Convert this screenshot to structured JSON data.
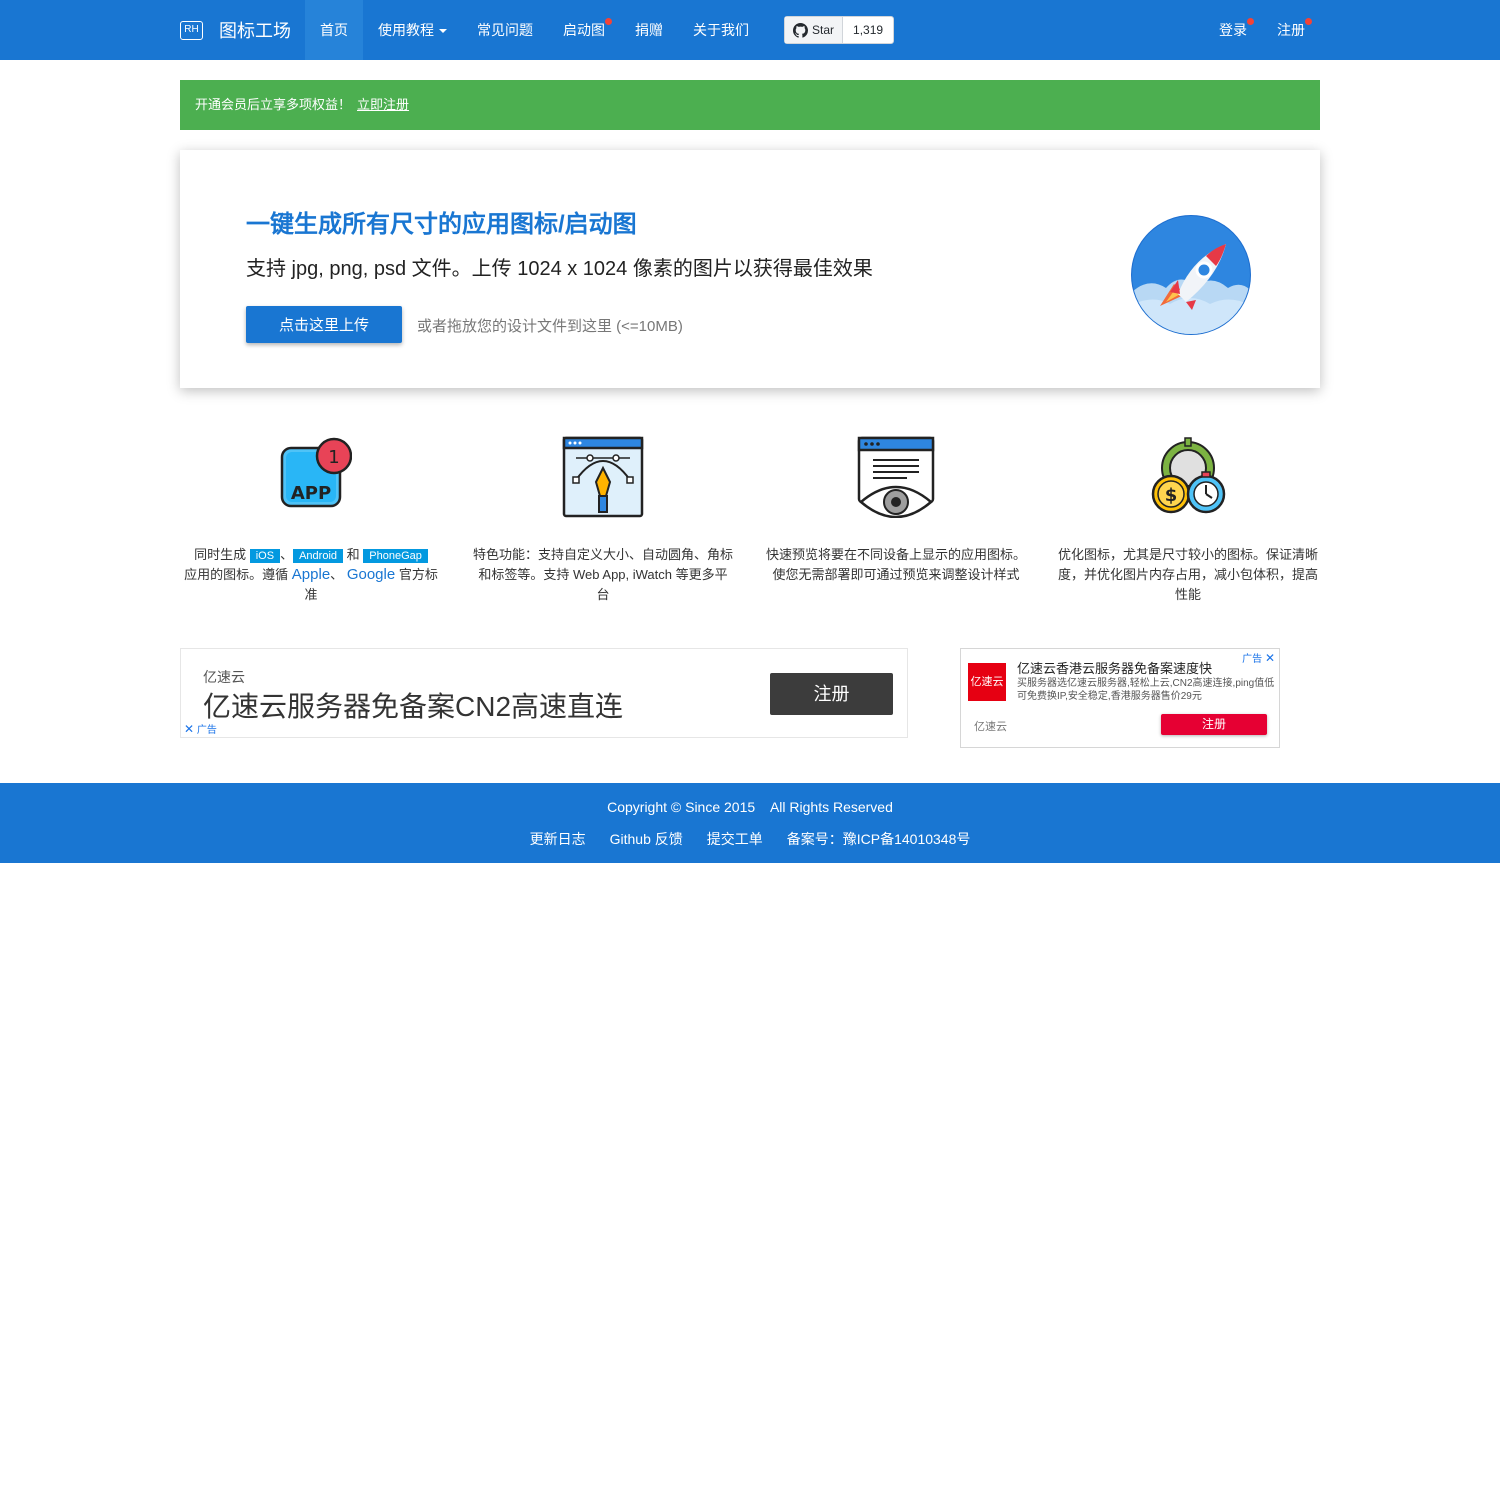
{
  "nav": {
    "logo": "RH",
    "brand": "图标工场",
    "links": [
      "首页",
      "使用教程",
      "常见问题",
      "启动图",
      "捐赠",
      "关于我们"
    ],
    "github": {
      "star_label": "Star",
      "count": "1,319"
    },
    "right": [
      "登录",
      "注册"
    ]
  },
  "promo": {
    "text": "开通会员后立享多项权益！",
    "link": "立即注册"
  },
  "hero": {
    "title": "一键生成所有尺寸的应用图标/启动图",
    "subtitle": "支持 jpg, png, psd 文件。上传 1024 x 1024 像素的图片以获得最佳效果",
    "button": "点击这里上传",
    "hint": "或者拖放您的设计文件到这里 (<=10MB)"
  },
  "features": {
    "f1": {
      "icon_text": "APP",
      "badge_count": "1",
      "p1": "同时生成",
      "ios": "iOS",
      "sep1": "、",
      "android": "Android",
      "and": "和",
      "phonegap": "PhoneGap",
      "p2": "应用的图标。遵循",
      "apple": "Apple",
      "sep2": "、",
      "google": "Google",
      "p3": "官方标准"
    },
    "f2": {
      "text": "特色功能：支持自定义大小、自动圆角、角标和标签等。支持 Web App, iWatch 等更多平台"
    },
    "f3": {
      "text": "快速预览将要在不同设备上显示的应用图标。使您无需部署即可通过预览来调整设计样式"
    },
    "f4": {
      "text": "优化图标，尤其是尺寸较小的图标。保证清晰度，并优化图片内存占用，减小包体积，提高性能"
    }
  },
  "ad1": {
    "brand": "亿速云",
    "title": "亿速云服务器免备案CN2高速直连",
    "button": "注册",
    "mark": "广告"
  },
  "ad2": {
    "logo": "亿速云",
    "title": "亿速云香港云服务器免备案速度快",
    "desc": "买服务器选亿速云服务器,轻松上云,CN2高速连接,ping值低可免费换IP,安全稳定,香港服务器售价29元",
    "brand": "亿速云",
    "button": "注册",
    "tag": "广告"
  },
  "footer": {
    "copyright": "Copyright © Since 2015    All Rights Reserved",
    "links": [
      "更新日志",
      "Github 反馈",
      "提交工单",
      "备案号：豫ICP备14010348号"
    ]
  },
  "colors": {
    "primary": "#1976d2",
    "promo": "#4caf50",
    "badge": "#0399e0",
    "ad_red": "#e60033"
  }
}
